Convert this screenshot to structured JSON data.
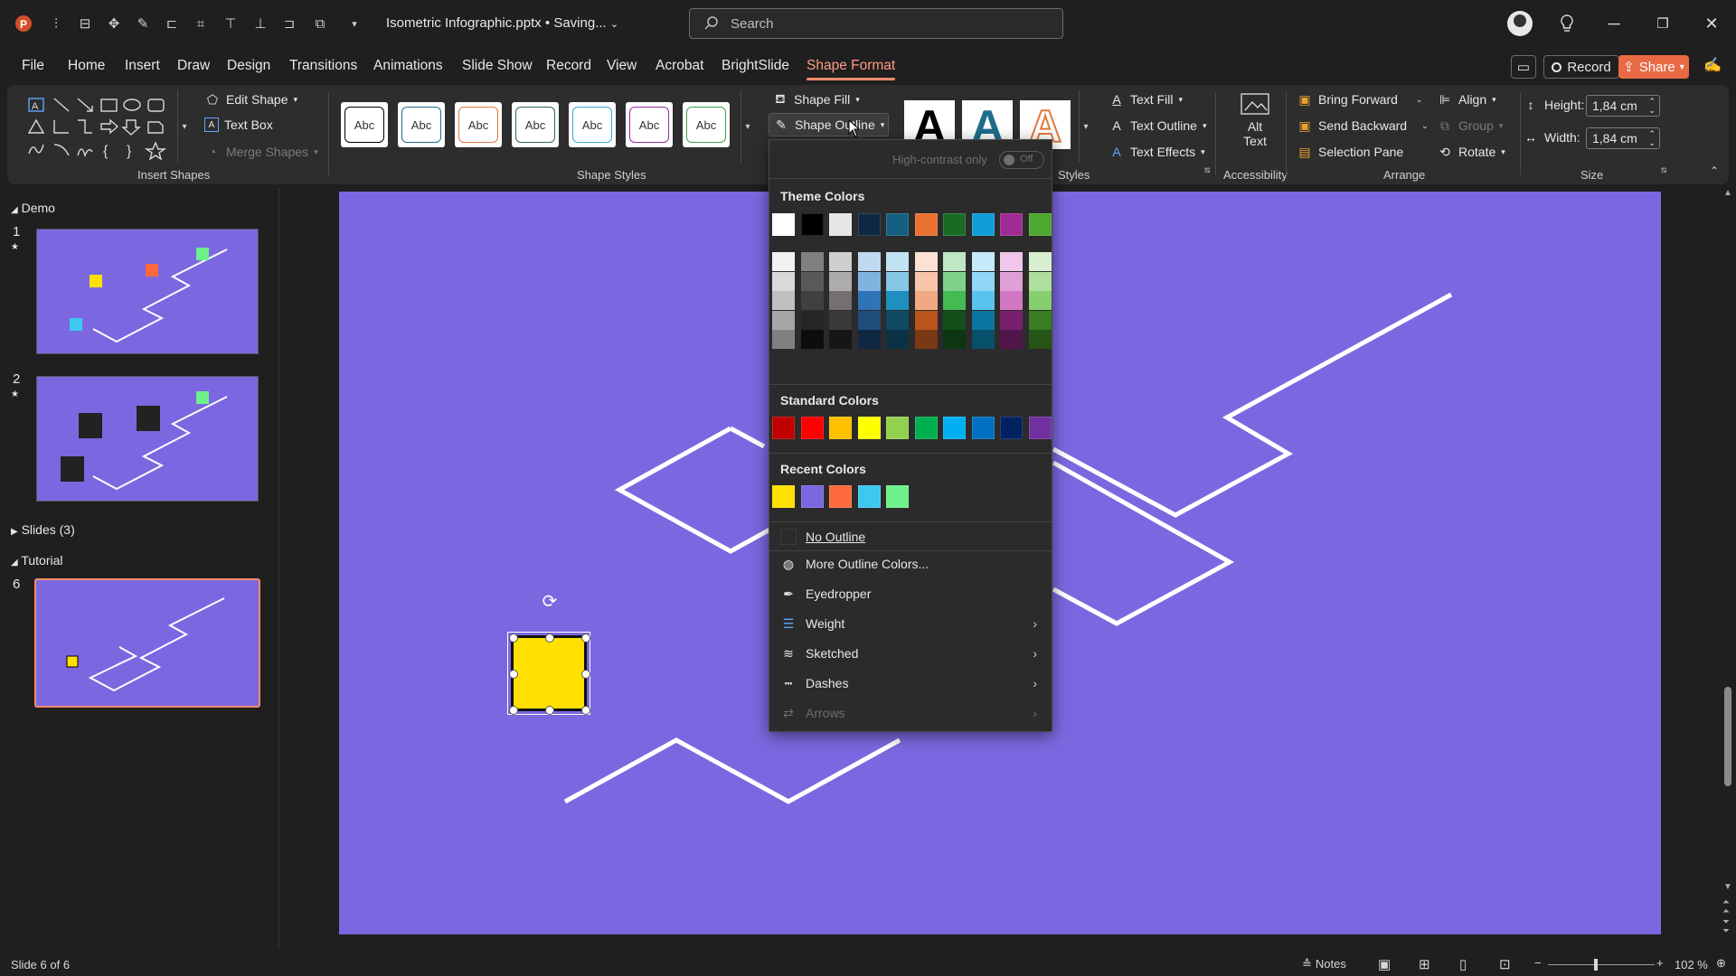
{
  "titlebar": {
    "doc_title": "Isometric Infographic.pptx • Saving...",
    "search_placeholder": "Search"
  },
  "tabs": [
    "File",
    "Home",
    "Insert",
    "Draw",
    "Design",
    "Transitions",
    "Animations",
    "Slide Show",
    "Record",
    "View",
    "Acrobat",
    "BrightSlide",
    "Shape Format"
  ],
  "active_tab": "Shape Format",
  "top_buttons": {
    "record": "Record",
    "share": "Share"
  },
  "ribbon": {
    "insert_shapes": {
      "label": "Insert Shapes",
      "edit_shape": "Edit Shape",
      "text_box": "Text Box",
      "merge_shapes": "Merge Shapes"
    },
    "shape_styles": {
      "label": "Shape Styles",
      "swatch_text": "Abc",
      "swatch_colors": [
        "#000000",
        "#1e6f8a",
        "#e07a3c",
        "#2e6b4a",
        "#3aa8d8",
        "#9b2b9b",
        "#3aa34a"
      ],
      "shape_fill": "Shape Fill",
      "shape_outline": "Shape Outline"
    },
    "wordart": {
      "label": "Styles",
      "text_fill": "Text Fill",
      "text_outline": "Text Outline",
      "text_effects": "Text Effects"
    },
    "accessibility": {
      "label": "Accessibility",
      "alt_text_1": "Alt",
      "alt_text_2": "Text"
    },
    "arrange": {
      "label": "Arrange",
      "bring_forward": "Bring Forward",
      "send_backward": "Send Backward",
      "selection_pane": "Selection Pane",
      "align": "Align",
      "group": "Group",
      "rotate": "Rotate"
    },
    "size": {
      "label": "Size",
      "height_label": "Height:",
      "height_value": "1,84 cm",
      "width_label": "Width:",
      "width_value": "1,84 cm"
    }
  },
  "panel": {
    "sections": [
      {
        "name": "Demo"
      },
      {
        "name": "Slides (3)"
      },
      {
        "name": "Tutorial"
      }
    ],
    "slide_numbers": [
      "1",
      "2",
      "6"
    ]
  },
  "dropdown": {
    "high_contrast": "High-contrast only",
    "toggle_state": "Off",
    "theme_colors_title": "Theme Colors",
    "theme_colors": [
      "#ffffff",
      "#000000",
      "#e7e6e6",
      "#0e2841",
      "#156082",
      "#e97132",
      "#196b24",
      "#0f9ed5",
      "#a02b93",
      "#4ea72e"
    ],
    "theme_shades": [
      [
        "#f2f2f2",
        "#d9d9d9",
        "#bfbfbf",
        "#a6a6a6",
        "#808080"
      ],
      [
        "#808080",
        "#595959",
        "#404040",
        "#262626",
        "#0d0d0d"
      ],
      [
        "#d0cece",
        "#aeabab",
        "#757070",
        "#3a3838",
        "#171616"
      ],
      [
        "#c0d9f0",
        "#81b3e1",
        "#2f73b8",
        "#1f4d7a",
        "#0f2740"
      ],
      [
        "#c2e3f2",
        "#85c8e6",
        "#1f8fc0",
        "#104b66",
        "#0a3244"
      ],
      [
        "#fbe2d5",
        "#f7c5ab",
        "#f2a882",
        "#b9541d",
        "#7a3814"
      ],
      [
        "#bde8c3",
        "#7fd189",
        "#44ba52",
        "#135019",
        "#0d3511"
      ],
      [
        "#c7ebfa",
        "#90d6f5",
        "#58c2f0",
        "#0b77a0",
        "#07506b"
      ],
      [
        "#f0c7eb",
        "#e19fd8",
        "#d277c4",
        "#78206e",
        "#501549"
      ],
      [
        "#d7efcf",
        "#aedf9f",
        "#86cf70",
        "#3a7d22",
        "#275417"
      ]
    ],
    "standard_colors_title": "Standard Colors",
    "standard_colors": [
      "#c00000",
      "#ff0000",
      "#ffc000",
      "#ffff00",
      "#92d050",
      "#00b050",
      "#00b0f0",
      "#0070c0",
      "#002060",
      "#7030a0"
    ],
    "recent_colors_title": "Recent Colors",
    "recent_colors": [
      "#ffe000",
      "#7b68e0",
      "#ff6a3d",
      "#3ec8f0",
      "#6ef08a"
    ],
    "items": {
      "no_outline": "No Outline",
      "more_colors": "More Outline Colors...",
      "eyedropper": "Eyedropper",
      "weight": "Weight",
      "sketched": "Sketched",
      "dashes": "Dashes",
      "arrows": "Arrows"
    }
  },
  "slide": {
    "background": "#7b68e0",
    "shape_color": "#ffe000"
  },
  "status": {
    "slide_counter": "Slide 6 of 6",
    "notes": "Notes",
    "zoom": "102 %"
  }
}
